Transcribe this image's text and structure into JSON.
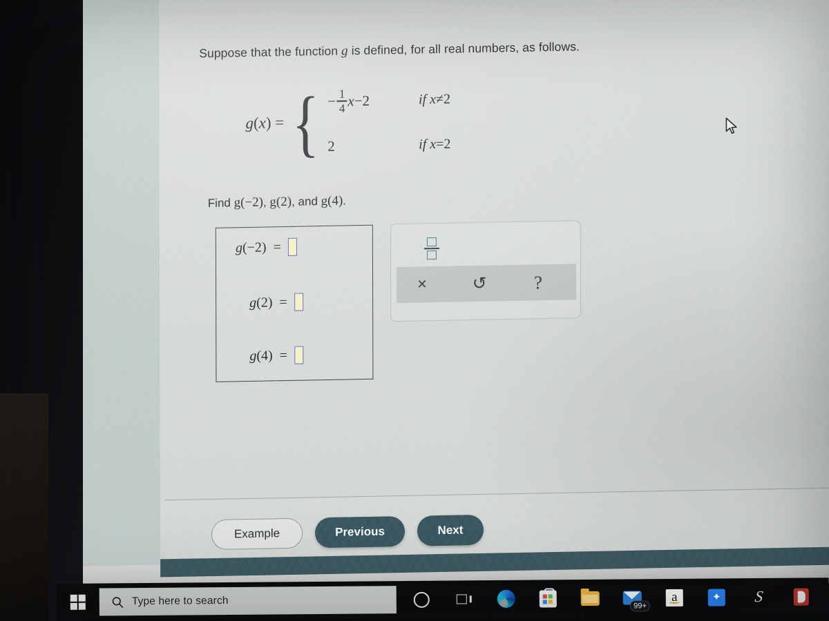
{
  "problem": {
    "prompt_before": "Suppose that the function",
    "prompt_variable": "g",
    "prompt_after": "is defined, for all real numbers, as follows.",
    "function_lhs_name": "g",
    "function_lhs_open": "(",
    "function_lhs_var": "x",
    "function_lhs_close": ")",
    "function_lhs_equals": "=",
    "cases": [
      {
        "sign": "−",
        "numerator": "1",
        "denominator": "4",
        "variable": "x",
        "tail": "−2",
        "condition_if": "if",
        "condition_var": "x",
        "condition_op": "≠",
        "condition_val": "2"
      },
      {
        "value": "2",
        "condition_if": "if",
        "condition_var": "x",
        "condition_op": "=",
        "condition_val": "2"
      }
    ],
    "find_label": "Find",
    "find_items": [
      "g(−2)",
      "g(2)",
      "g(4)"
    ],
    "find_sentence_tail": "and",
    "find_period": "."
  },
  "answer_panel": {
    "rows": [
      {
        "fn": "g",
        "arg": "(−2)",
        "equals": "=",
        "value": ""
      },
      {
        "fn": "g",
        "arg": "(2)",
        "equals": "=",
        "value": ""
      },
      {
        "fn": "g",
        "arg": "(4)",
        "equals": "=",
        "value": ""
      }
    ],
    "input_border_color": "#5a5fc4",
    "input_fill_color": "#f4f0c4"
  },
  "tool_palette": {
    "fraction_button_label": "fraction-template",
    "clear_label": "×",
    "undo_label": "↺",
    "help_label": "?"
  },
  "navigation": {
    "example_label": "Example",
    "previous_label": "Previous",
    "next_label": "Next",
    "primary_button_color": "#2a4852",
    "footer_bar_color": "#2c4a52"
  },
  "taskbar": {
    "start_label": "windows-start",
    "search_placeholder": "Type here to search",
    "items": [
      {
        "name": "cortana",
        "label": "Cortana"
      },
      {
        "name": "task-view",
        "label": "Task View"
      },
      {
        "name": "edge",
        "label": "Microsoft Edge"
      },
      {
        "name": "store",
        "label": "Microsoft Store"
      },
      {
        "name": "file-explorer",
        "label": "File Explorer"
      },
      {
        "name": "mail",
        "label": "Mail",
        "badge": "99+"
      },
      {
        "name": "amazon",
        "label": "a"
      },
      {
        "name": "dropbox",
        "label": "Dropbox"
      },
      {
        "name": "slash-app",
        "label": "S"
      },
      {
        "name": "office",
        "label": "Office"
      }
    ]
  }
}
